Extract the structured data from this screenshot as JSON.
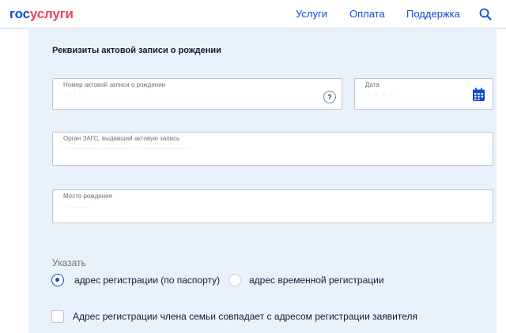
{
  "header": {
    "logo_part1": "гос",
    "logo_part2": "услуги",
    "nav": [
      "Услуги",
      "Оплата",
      "Поддержка"
    ],
    "search_icon": "search-icon"
  },
  "form": {
    "title": "Реквизиты актовой записи о рождении",
    "record_number": {
      "label": "Номер актовой записи о рождении",
      "value": "· · · ·",
      "help_icon": "question-icon"
    },
    "date": {
      "label": "Дата",
      "value": "·· ·· ·· ··",
      "icon": "calendar-icon"
    },
    "registry_office": {
      "label": "Орган ЗАГС, выдавший актовую запись",
      "value": "··············································"
    },
    "birth_place": {
      "label": "Место рождения",
      "value": "· ········"
    },
    "indicate_label": "Указать",
    "radio_options": [
      {
        "label": "адрес регистрации (по паспорту)",
        "selected": true
      },
      {
        "label": "адрес временной регистрации",
        "selected": false
      }
    ],
    "checkbox": {
      "label": "Адрес регистрации члена семьи совпадает с адресом регистрации заявителя",
      "checked": false
    }
  },
  "colors": {
    "brand_blue": "#0d4cd3",
    "brand_red": "#ee3f58",
    "background": "#e9f2fa"
  }
}
